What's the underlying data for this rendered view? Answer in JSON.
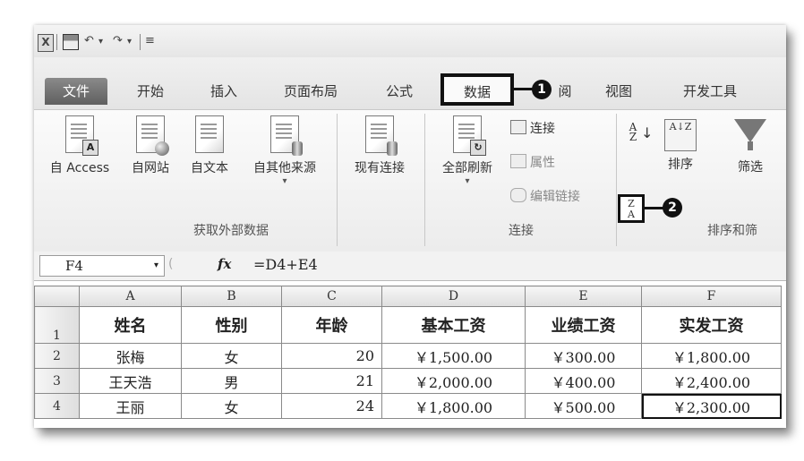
{
  "qat": {
    "excel_logo": "X",
    "undo_symbol": "↶",
    "redo_symbol": "↷",
    "dropdown_symbol": "▾",
    "customize_symbol": "≡"
  },
  "tabs": {
    "file": "文件",
    "home": "开始",
    "insert": "插入",
    "page_layout": "页面布局",
    "formulas": "公式",
    "data": "数据",
    "review_partial": "阅",
    "view": "视图",
    "developer": "开发工具"
  },
  "callouts": {
    "one": "1",
    "two": "2"
  },
  "ribbon": {
    "get_external": {
      "access": "自 Access",
      "web": "自网站",
      "text": "自文本",
      "other": "自其他来源",
      "existing": "现有连接",
      "group_label": "获取外部数据"
    },
    "connections": {
      "refresh_all": "全部刷新",
      "connections": "连接",
      "properties": "属性",
      "edit_links": "编辑链接",
      "group_label": "连接"
    },
    "sort_filter": {
      "sort_asc": "A↓Z",
      "sort": "排序",
      "filter": "筛选",
      "group_label": "排序和筛"
    }
  },
  "formula_bar": {
    "name_box": "F4",
    "fx": "fx",
    "formula": "=D4+E4"
  },
  "grid": {
    "col_headers": [
      "A",
      "B",
      "C",
      "D",
      "E",
      "F"
    ],
    "header_row": {
      "row": "1",
      "cells": [
        "姓名",
        "性别",
        "年龄",
        "基本工资",
        "业绩工资",
        "实发工资"
      ]
    },
    "rows": [
      {
        "row": "2",
        "cells": [
          "张梅",
          "女",
          "20",
          "￥1,500.00",
          "￥300.00",
          "￥1,800.00"
        ]
      },
      {
        "row": "3",
        "cells": [
          "王天浩",
          "男",
          "21",
          "￥2,000.00",
          "￥400.00",
          "￥2,400.00"
        ]
      },
      {
        "row": "4",
        "cells": [
          "王丽",
          "女",
          "24",
          "￥1,800.00",
          "￥500.00",
          "￥2,300.00"
        ]
      }
    ]
  }
}
